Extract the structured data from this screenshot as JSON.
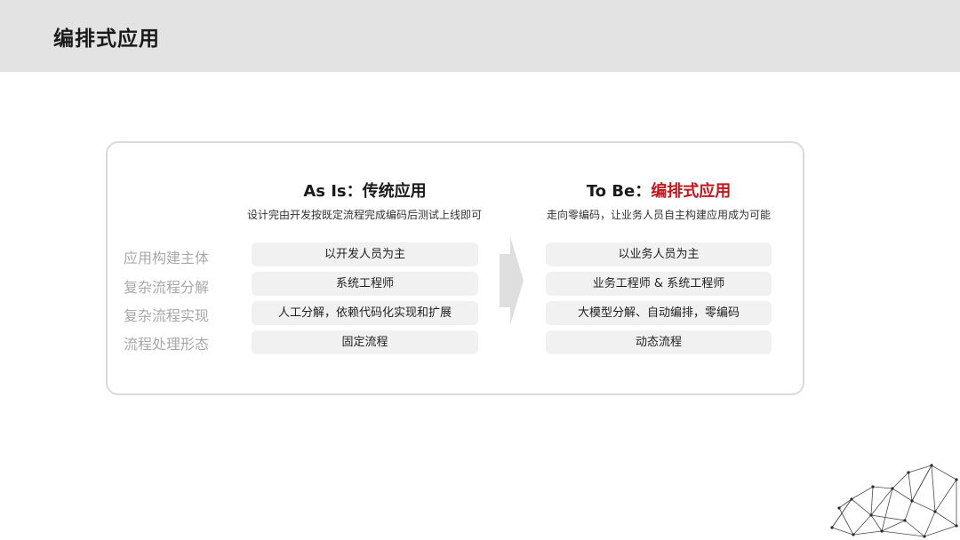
{
  "page": {
    "title": "编排式应用"
  },
  "as_is": {
    "title_prefix": "As Is：",
    "title_name": "传统应用",
    "subtitle": "设计完由开发按既定流程完成编码后测试上线即可"
  },
  "to_be": {
    "title_prefix": "To Be：",
    "title_name": "编排式应用",
    "subtitle": "走向零编码，让业务人员自主构建应用成为可能"
  },
  "rows": [
    {
      "label": "应用构建主体",
      "as_is": "以开发人员为主",
      "to_be": "以业务人员为主"
    },
    {
      "label": "复杂流程分解",
      "as_is": "系统工程师",
      "to_be": "业务工程师 & 系统工程师"
    },
    {
      "label": "复杂流程实现",
      "as_is": "人工分解，依赖代码化实现和扩展",
      "to_be": "大模型分解、自动编排，零编码"
    },
    {
      "label": "流程处理形态",
      "as_is": "固定流程",
      "to_be": "动态流程"
    }
  ],
  "colors": {
    "accent": "#c4161c",
    "header_bg": "#e3e3e3",
    "pill_bg": "#f1f1f1",
    "label": "#a8a8a8"
  },
  "icons": {
    "arrow": "right-arrow-icon",
    "decoration": "network-mesh-icon"
  }
}
